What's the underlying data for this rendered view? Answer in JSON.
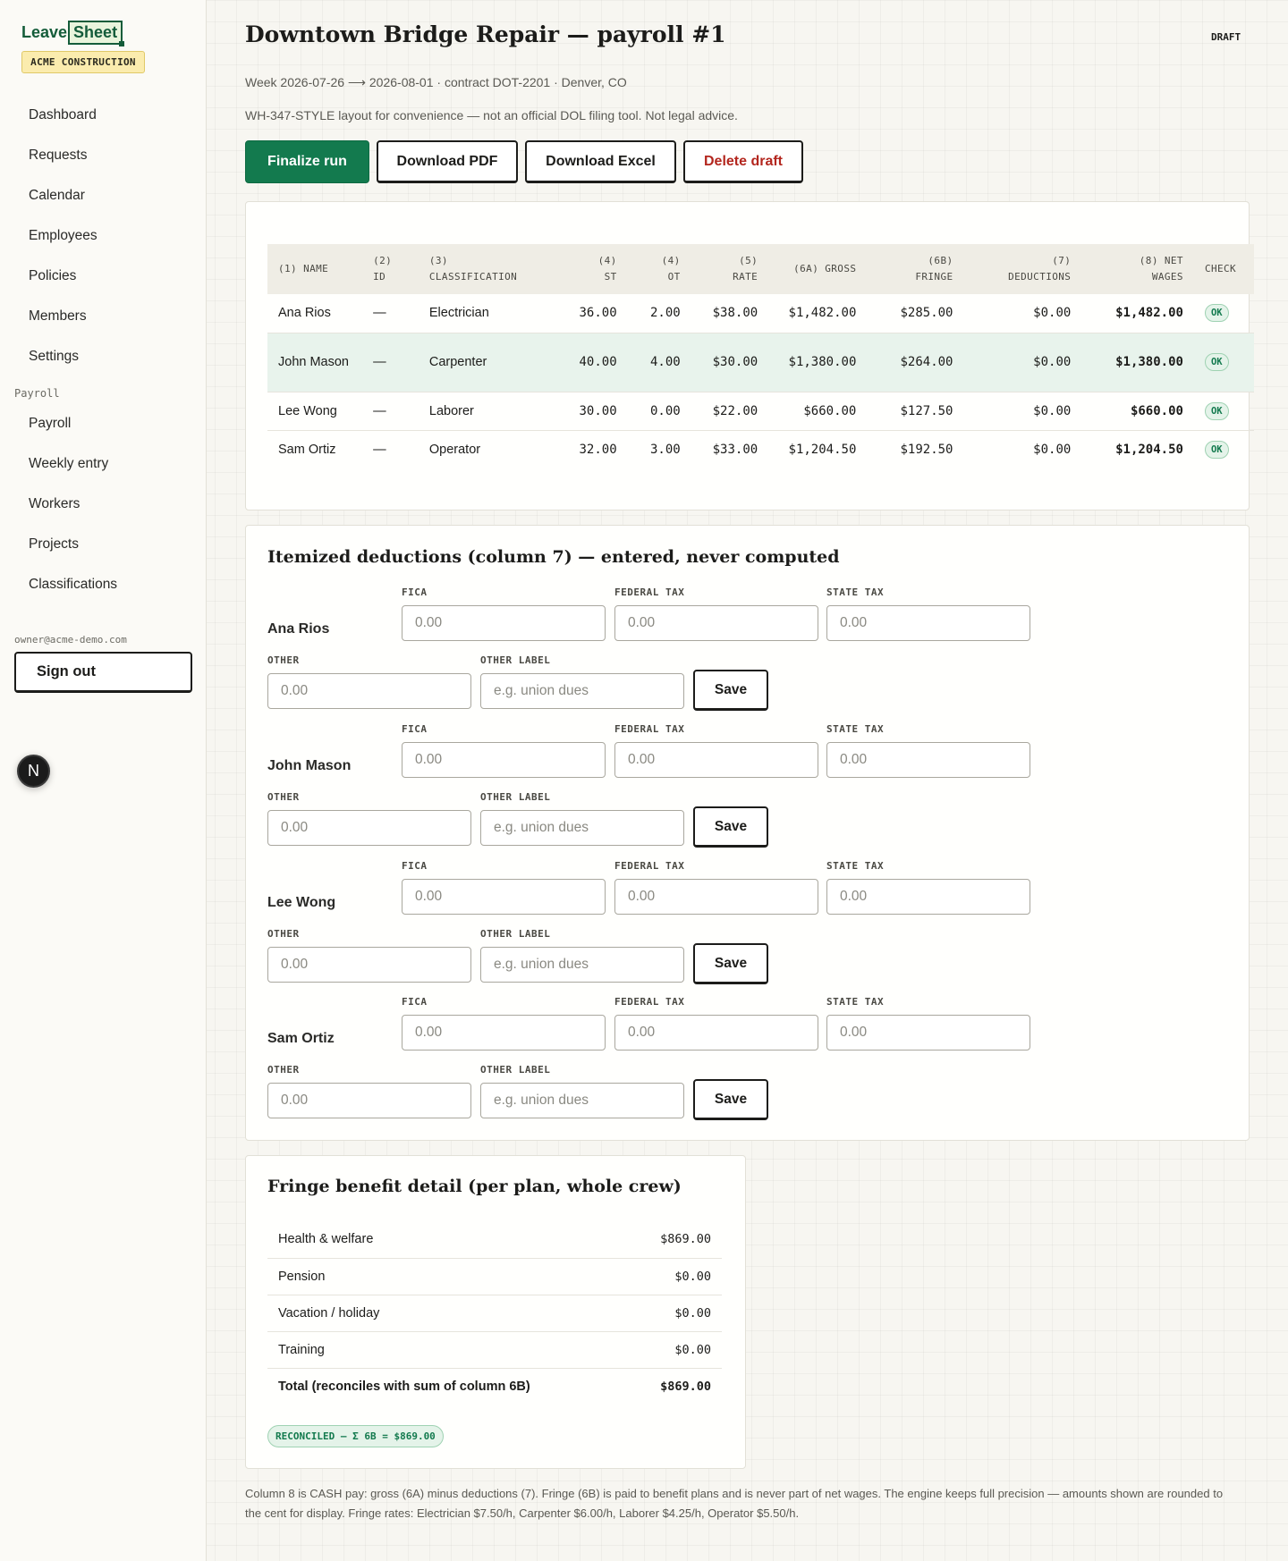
{
  "app": {
    "logo_part1": "Leave",
    "logo_part2": "Sheet",
    "org_badge": "ACME CONSTRUCTION"
  },
  "sidebar": {
    "items": [
      {
        "label": "Dashboard"
      },
      {
        "label": "Requests"
      },
      {
        "label": "Calendar"
      },
      {
        "label": "Employees"
      },
      {
        "label": "Policies"
      },
      {
        "label": "Members"
      },
      {
        "label": "Settings"
      }
    ],
    "section_label": "Payroll",
    "payroll_items": [
      {
        "label": "Payroll"
      },
      {
        "label": "Weekly entry"
      },
      {
        "label": "Workers"
      },
      {
        "label": "Projects"
      },
      {
        "label": "Classifications"
      }
    ],
    "user_email": "owner@acme-demo.com",
    "sign_out": "Sign out",
    "dev_badge": "N"
  },
  "header": {
    "title": "Downtown Bridge Repair — payroll #1",
    "status": "DRAFT",
    "subtitle": "Week 2026-07-26 ⟶ 2026-08-01 · contract DOT-2201 · Denver, CO",
    "disclaimer": "WH-347-STYLE layout for convenience — not an official DOL filing tool. Not legal advice."
  },
  "actions": {
    "finalize": "Finalize run",
    "download_pdf": "Download PDF",
    "download_excel": "Download Excel",
    "delete_draft": "Delete draft"
  },
  "payroll_table": {
    "headers": {
      "name": "(1) NAME",
      "id_1": "(2)",
      "id_2": "ID",
      "class_1": "(3)",
      "class_2": "CLASSIFICATION",
      "st_1": "(4)",
      "st_2": "ST",
      "ot_1": "(4)",
      "ot_2": "OT",
      "rate_1": "(5)",
      "rate_2": "RATE",
      "gross": "(6A) GROSS",
      "fringe_1": "(6B)",
      "fringe_2": "FRINGE",
      "ded_1": "(7)",
      "ded_2": "DEDUCTIONS",
      "net_1": "(8) NET",
      "net_2": "WAGES",
      "check": "CHECK"
    },
    "rows": [
      {
        "name": "Ana Rios",
        "id": "—",
        "classification": "Electrician",
        "st": "36.00",
        "ot": "2.00",
        "rate": "$38.00",
        "gross": "$1,482.00",
        "fringe": "$285.00",
        "deductions": "$0.00",
        "net": "$1,482.00",
        "check": "OK"
      },
      {
        "name": "John Mason",
        "id": "—",
        "classification": "Carpenter",
        "st": "40.00",
        "ot": "4.00",
        "rate": "$30.00",
        "gross": "$1,380.00",
        "fringe": "$264.00",
        "deductions": "$0.00",
        "net": "$1,380.00",
        "check": "OK"
      },
      {
        "name": "Lee Wong",
        "id": "—",
        "classification": "Laborer",
        "st": "30.00",
        "ot": "0.00",
        "rate": "$22.00",
        "gross": "$660.00",
        "fringe": "$127.50",
        "deductions": "$0.00",
        "net": "$660.00",
        "check": "OK"
      },
      {
        "name": "Sam Ortiz",
        "id": "—",
        "classification": "Operator",
        "st": "32.00",
        "ot": "3.00",
        "rate": "$33.00",
        "gross": "$1,204.50",
        "fringe": "$192.50",
        "deductions": "$0.00",
        "net": "$1,204.50",
        "check": "OK"
      }
    ]
  },
  "deductions": {
    "title": "Itemized deductions (column 7) — entered, never computed",
    "labels": {
      "fica": "FICA",
      "federal": "FEDERAL TAX",
      "state": "STATE TAX",
      "other": "OTHER",
      "other_label": "OTHER LABEL"
    },
    "save_label": "Save",
    "employees": [
      {
        "name": "Ana Rios",
        "fica_placeholder": "0.00",
        "federal_placeholder": "0.00",
        "state_placeholder": "0.00",
        "other_placeholder": "0.00",
        "other_label_placeholder": "e.g. union dues"
      },
      {
        "name": "John Mason",
        "fica_placeholder": "0.00",
        "federal_placeholder": "0.00",
        "state_placeholder": "0.00",
        "other_placeholder": "0.00",
        "other_label_placeholder": "e.g. union dues"
      },
      {
        "name": "Lee Wong",
        "fica_placeholder": "0.00",
        "federal_placeholder": "0.00",
        "state_placeholder": "0.00",
        "other_placeholder": "0.00",
        "other_label_placeholder": "e.g. union dues"
      },
      {
        "name": "Sam Ortiz",
        "fica_placeholder": "0.00",
        "federal_placeholder": "0.00",
        "state_placeholder": "0.00",
        "other_placeholder": "0.00",
        "other_label_placeholder": "e.g. union dues"
      }
    ]
  },
  "fringe": {
    "title": "Fringe benefit detail (per plan, whole crew)",
    "rows": [
      {
        "label": "Health & welfare",
        "amount": "$869.00"
      },
      {
        "label": "Pension",
        "amount": "$0.00"
      },
      {
        "label": "Vacation / holiday",
        "amount": "$0.00"
      },
      {
        "label": "Training",
        "amount": "$0.00"
      }
    ],
    "total_label": "Total (reconciles with sum of column 6B)",
    "total_amount": "$869.00",
    "reconciled_badge": "RECONCILED — Σ 6B = $869.00"
  },
  "footnote": "Column 8 is CASH pay: gross (6A) minus deductions (7). Fringe (6B) is paid to benefit plans and is never part of net wages. The engine keeps full precision — amounts shown are rounded to the cent for display. Fringe rates: Electrician $7.50/h, Carpenter $6.00/h, Laborer $4.25/h, Operator $5.50/h.",
  "colors": {
    "accent": "#137a4e",
    "danger": "#b3261e",
    "badge_bg": "#fbecae",
    "highlight_row": "#e8f3ec"
  }
}
